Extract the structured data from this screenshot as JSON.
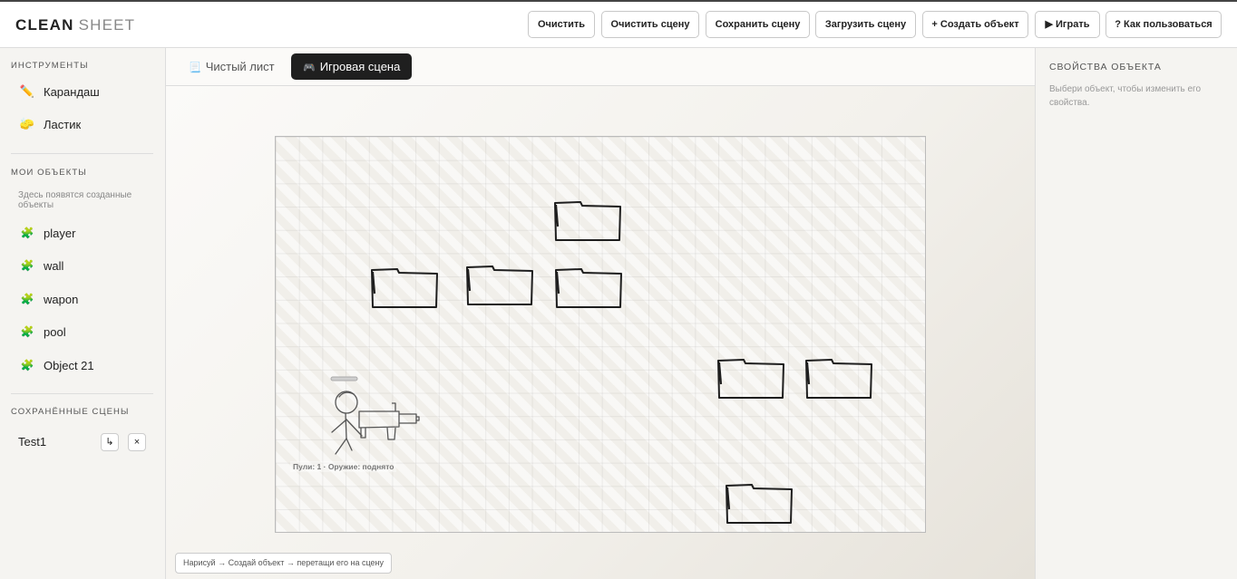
{
  "app": {
    "logo_bold": "CLEAN",
    "logo_light": "SHEET"
  },
  "toolbar": {
    "clear": "Очистить",
    "clear_scene": "Очистить сцену",
    "save_scene": "Сохранить сцену",
    "load_scene": "Загрузить сцену",
    "create_object": "+ Создать объект",
    "play": "▶ Играть",
    "help": "? Как пользоваться"
  },
  "sidebar": {
    "tools_title": "ИНСТРУМЕНТЫ",
    "tools": [
      {
        "label": "Карандаш",
        "icon": "pencil-icon"
      },
      {
        "label": "Ластик",
        "icon": "eraser-icon"
      }
    ],
    "objects_title": "МОИ ОБЪЕКТЫ",
    "objects_hint": "Здесь появятся созданные объекты",
    "objects": [
      {
        "label": "player",
        "icon": "puzzle-icon"
      },
      {
        "label": "wall",
        "icon": "puzzle-icon"
      },
      {
        "label": "wapon",
        "icon": "puzzle-icon"
      },
      {
        "label": "pool",
        "icon": "puzzle-icon"
      },
      {
        "label": "Object 21",
        "icon": "puzzle-icon"
      }
    ],
    "scenes_title": "СОХРАНЁННЫЕ СЦЕНЫ",
    "scenes": [
      {
        "name": "Test1",
        "load": "↳",
        "delete": "×"
      }
    ]
  },
  "tabs": [
    {
      "label": "Чистый лист",
      "icon": "page-icon",
      "active": false
    },
    {
      "label": "Игровая сцена",
      "icon": "gamepad-icon",
      "active": true
    }
  ],
  "scene": {
    "hud": "Пули: 1 · Оружие: поднято",
    "status_hint": "Нарисуй → Создай объект → перетащи его на сцену"
  },
  "properties": {
    "title": "СВОЙСТВА ОБЪЕКТА",
    "hint": "Выбери объект, чтобы изменить его свойства."
  }
}
